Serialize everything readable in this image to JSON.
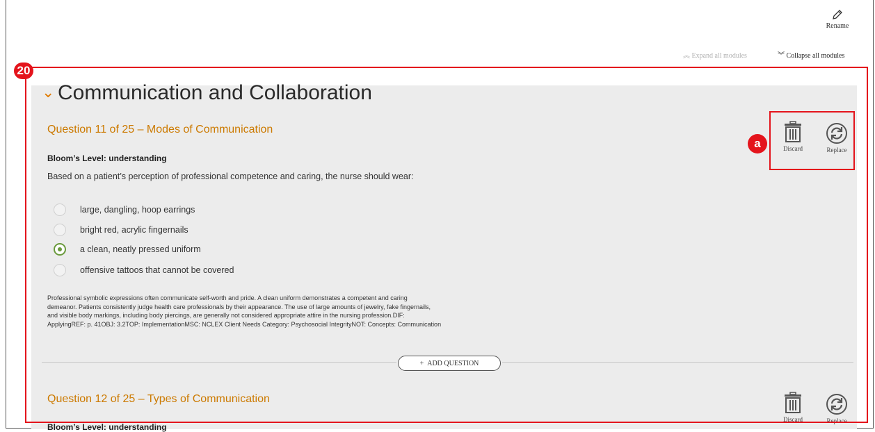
{
  "toolbar": {
    "rename_label": "Rename",
    "expand_all_label": "Expand all modules",
    "collapse_all_label": "Collapse all modules"
  },
  "callouts": {
    "main": "20",
    "actions": "a"
  },
  "module": {
    "title": "Communication and Collaboration",
    "add_question_label": "ADD QUESTION",
    "add_question_icon": "+",
    "questions": [
      {
        "title": "Question 11 of 25 – Modes of Communication",
        "bloom": "Bloom’s Level: understanding",
        "stem": "Based on a patient’s perception of professional competence and caring, the nurse should wear:",
        "options": [
          "large, dangling, hoop earrings",
          "bright red, acrylic fingernails",
          "a clean, neatly pressed uniform",
          "offensive tattoos that cannot be covered"
        ],
        "selected_index": 2,
        "rationale": [
          "Professional symbolic expressions often communicate self-worth and pride. A clean uniform demonstrates a competent and caring",
          "demeanor. Patients consistently judge health care professionals by their appearance. The use of large amounts of jewelry, fake fingernails,",
          "and visible body markings, including body piercings, are generally not considered appropriate attire in the nursing profession.DIF:",
          "ApplyingREF: p. 41OBJ: 3.2TOP: ImplementationMSC: NCLEX Client Needs Category: Psychosocial IntegrityNOT: Concepts: Communication"
        ],
        "discard_label": "Discard",
        "replace_label": "Replace"
      },
      {
        "title": "Question 12 of 25 – Types of Communication",
        "bloom": "Bloom’s Level: understanding",
        "discard_label": "Discard",
        "replace_label": "Replace"
      }
    ]
  },
  "colors": {
    "accent": "#cc7a00",
    "callout": "#e4141c",
    "radio_selected": "#6a9a3c",
    "panel_bg": "#ececec"
  }
}
